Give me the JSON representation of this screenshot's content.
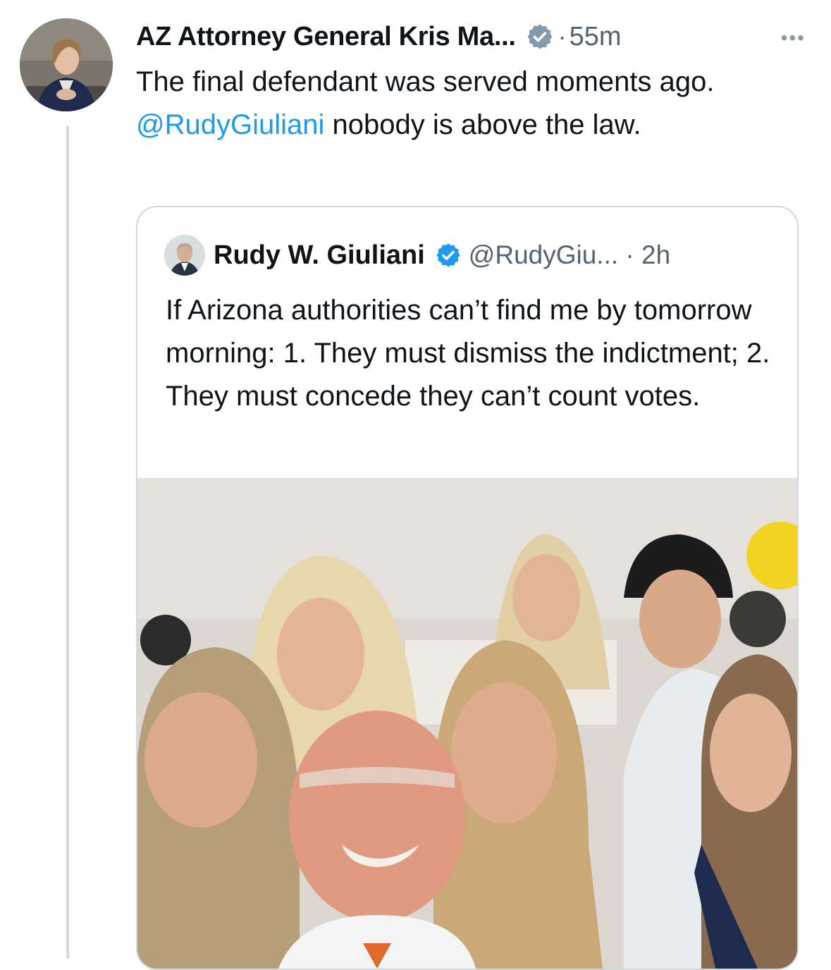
{
  "tweet": {
    "author_name": "AZ Attorney General Kris Ma...",
    "time": "55m",
    "separator": "·",
    "more_icon": "more-icon",
    "text_before": "The final defendant was served moments ago. ",
    "mention": "@RudyGiuliani",
    "text_after": " nobody is above the law."
  },
  "quote": {
    "author_name": "Rudy W. Giuliani",
    "handle_time": "@RudyGiu... · 2h",
    "text": "If Arizona authorities can’t find me by tomorrow morning: 1. They must dismiss the indictment; 2. They must concede they can’t count votes."
  },
  "colors": {
    "link": "#1d9bf0",
    "verified_blue": "#1d9bf0",
    "verified_gray": "#829aab",
    "secondary_text": "#536471",
    "border": "#cfd9de"
  }
}
